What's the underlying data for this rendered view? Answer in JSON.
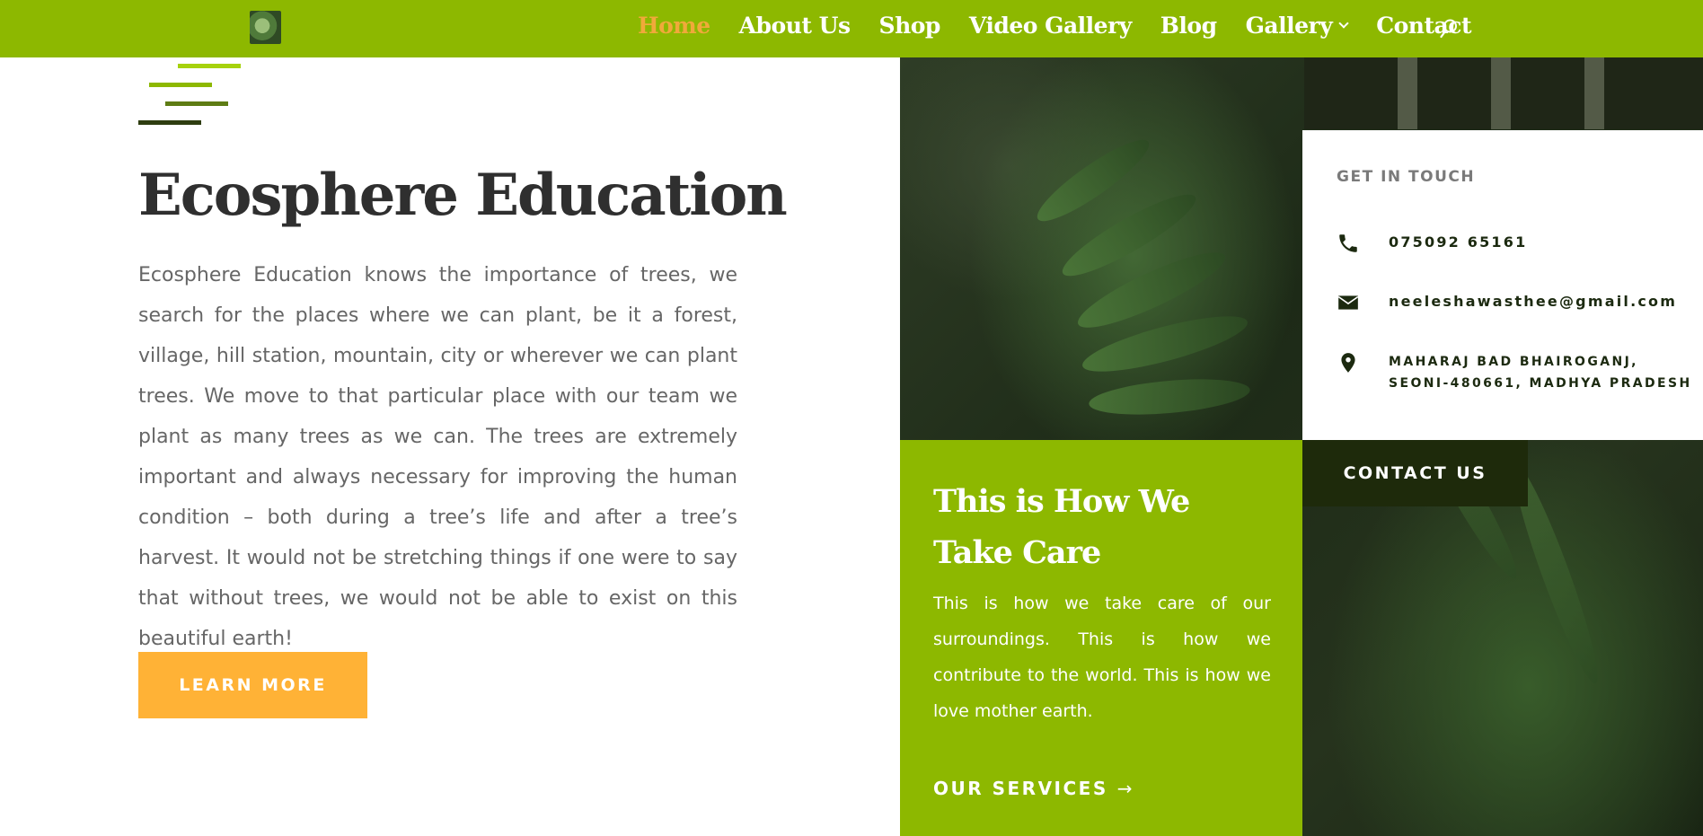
{
  "nav": {
    "items": [
      {
        "label": "Home",
        "active": true
      },
      {
        "label": "About Us"
      },
      {
        "label": "Shop"
      },
      {
        "label": "Video Gallery"
      },
      {
        "label": "Blog"
      },
      {
        "label": "Gallery",
        "has_dropdown": true
      },
      {
        "label": "Contact"
      }
    ],
    "search_icon": "search-icon",
    "colors": {
      "bar": "#8db800",
      "active": "#f0a93a",
      "text": "#ffffff"
    }
  },
  "hero": {
    "title": "Ecosphere Education",
    "body": "Ecosphere Education knows the importance of trees, we search for the places where we can plant,  be it a forest, village, hill station, mountain, city or wherever we can plant trees. We move to that particular place with our team we plant as many trees as we can. The trees are extremely important and always necessary for improving the human condition – both during a tree’s life and after a tree’s harvest. It would not be stretching things if one were to say that without trees, we would not be able to exist on this beautiful earth!",
    "button_label": "LEARN MORE",
    "button_color": "#ffb236"
  },
  "contact_card": {
    "heading": "GET IN TOUCH",
    "phone": "075092 65161",
    "email": "neeleshawasthee@gmail.com",
    "address_line1": "MAHARAJ BAD BHAIROGANJ,",
    "address_line2": "SEONI-480661, MADHYA PRADESH",
    "icons": [
      "phone-icon",
      "envelope-icon",
      "location-pin-icon"
    ]
  },
  "care": {
    "title": "This is How We Take Care",
    "text": "This is how we take care of our surroundings. This is how we contribute to the world. This is how we love mother earth.",
    "link_label": "OUR SERVICES",
    "link_arrow": "→"
  },
  "contact_button": {
    "label": "CONTACT US",
    "color": "#1e2a0b"
  }
}
